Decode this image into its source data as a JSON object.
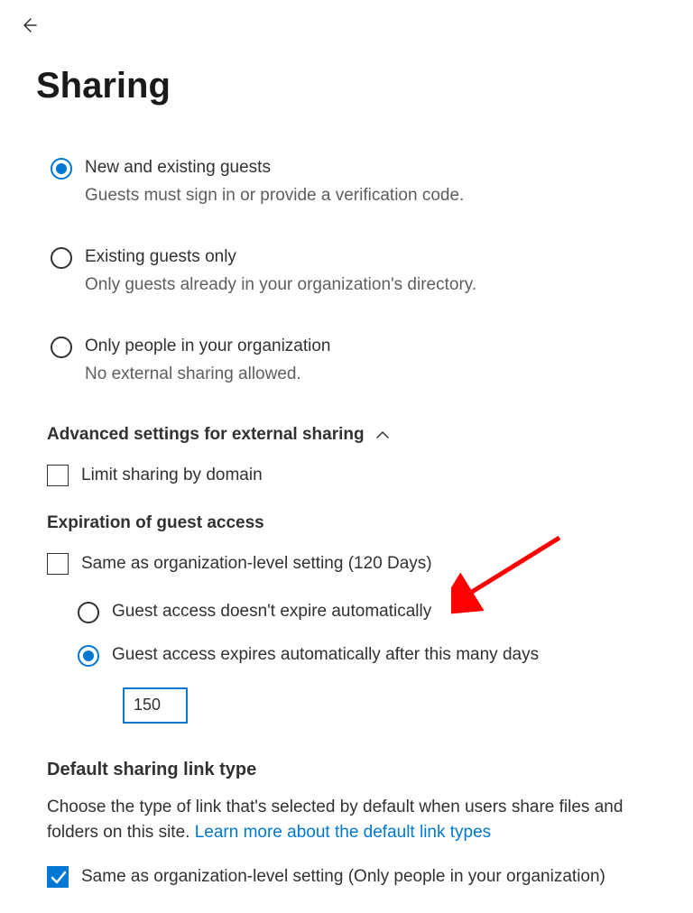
{
  "back_icon_name": "back-arrow-icon",
  "title": "Sharing",
  "guest_options": [
    {
      "label": "New and existing guests",
      "desc": "Guests must sign in or provide a verification code.",
      "selected": true
    },
    {
      "label": "Existing guests only",
      "desc": "Only guests already in your organization's directory.",
      "selected": false
    },
    {
      "label": "Only people in your organization",
      "desc": "No external sharing allowed.",
      "selected": false
    }
  ],
  "advanced_header": "Advanced settings for external sharing",
  "limit_domain": {
    "label": "Limit sharing by domain",
    "checked": false
  },
  "expiration_header": "Expiration of guest access",
  "expiration_same_org": {
    "label": "Same as organization-level setting (120 Days)",
    "checked": false
  },
  "expiration_options": [
    {
      "label": "Guest access doesn't expire automatically",
      "selected": false
    },
    {
      "label": "Guest access expires automatically after this many days",
      "selected": true
    }
  ],
  "expiration_days_value": "150",
  "default_link": {
    "title": "Default sharing link type",
    "desc_prefix": "Choose the type of link that's selected by default when users share files and folders on this site. ",
    "learn_more": "Learn more about the default link types",
    "same_org_label": "Same as organization-level setting (Only people in your organization)",
    "same_org_checked": true
  },
  "colors": {
    "primary": "#0078d4",
    "text": "#323130",
    "secondary_text": "#605e5c",
    "annotation": "#ff0000"
  }
}
